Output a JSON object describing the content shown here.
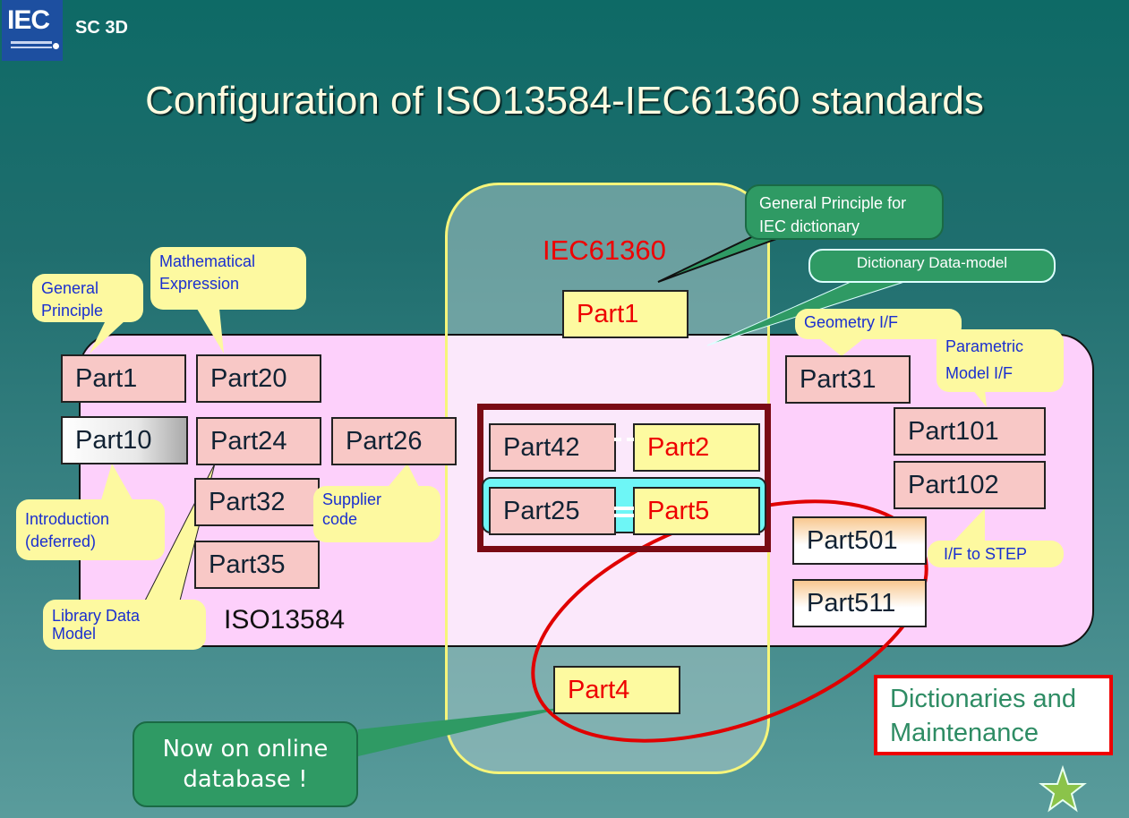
{
  "header": {
    "logo_text": "IEC",
    "committee": "SC 3D"
  },
  "title": "Configuration of ISO13584-IEC61360 standards",
  "regions": {
    "iec": "IEC61360",
    "iso": "ISO13584"
  },
  "iso_parts": {
    "part1": "Part1",
    "part20": "Part20",
    "part10": "Part10",
    "part24": "Part24",
    "part26": "Part26",
    "part32": "Part32",
    "part35": "Part35",
    "part31": "Part31",
    "part101": "Part101",
    "part102": "Part102",
    "part501": "Part501",
    "part511": "Part511",
    "part42": "Part42",
    "part25": "Part25"
  },
  "iec_parts": {
    "part1": "Part1",
    "part2": "Part2",
    "part5": "Part5",
    "part4": "Part4"
  },
  "callouts": {
    "general_principle": [
      "General",
      "Principle"
    ],
    "math_expression": [
      "Mathematical",
      "Expression"
    ],
    "introduction": [
      "Introduction",
      "(deferred)"
    ],
    "library_data_model": [
      "Library Data",
      "Model"
    ],
    "supplier_code": [
      "Supplier",
      "code"
    ],
    "geometry_if": "Geometry I/F",
    "parametric_model_if": [
      "Parametric",
      "Model I/F"
    ],
    "if_to_step": "I/F to STEP",
    "iec_general_principle": [
      "General Principle for",
      "IEC dictionary"
    ],
    "dictionary_data_model": "Dictionary Data-model",
    "online_database": [
      "Now on online",
      "database !"
    ]
  },
  "legend": {
    "dictionaries": [
      "Dictionaries and",
      "Maintenance"
    ]
  },
  "colors": {
    "highlight_ellipse": "#e00000",
    "frame": "#7a0a14",
    "iec_border": "#f6f57a"
  }
}
